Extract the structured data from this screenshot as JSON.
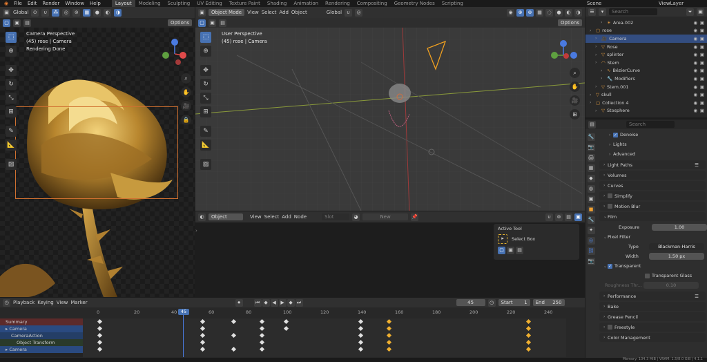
{
  "topbar": {
    "menus": [
      "File",
      "Edit",
      "Render",
      "Window",
      "Help"
    ],
    "workspaces": [
      "Layout",
      "Modeling",
      "Sculpting",
      "UV Editing",
      "Texture Paint",
      "Shading",
      "Animation",
      "Rendering",
      "Compositing",
      "Geometry Nodes",
      "Scripting"
    ],
    "active_workspace": "Layout",
    "scene": "Scene",
    "view_layer": "ViewLayer"
  },
  "left_viewport": {
    "orientation": "Global",
    "options": "Options",
    "title": "Camera Perspective",
    "subtitle": "(45) rose | Camera",
    "status": "Rendering Done"
  },
  "main_viewport": {
    "mode": "Object Mode",
    "menus": [
      "View",
      "Select",
      "Add",
      "Object"
    ],
    "orientation": "Global",
    "options": "Options",
    "title": "User Perspective",
    "subtitle": "(45) rose | Camera"
  },
  "node_editor": {
    "mode": "Object",
    "menus": [
      "View",
      "Select",
      "Add",
      "Node"
    ],
    "slot": "Slot",
    "new": "New",
    "active_tool_title": "Active Tool",
    "active_tool": "Select Box"
  },
  "outliner": {
    "search_placeholder": "Search",
    "items": [
      {
        "label": "Area.002",
        "indent": 2,
        "sel": false
      },
      {
        "label": "rose",
        "indent": 0,
        "sel": false
      },
      {
        "label": "Camera",
        "indent": 1,
        "sel": true
      },
      {
        "label": "Rose",
        "indent": 1,
        "sel": false
      },
      {
        "label": "splinter",
        "indent": 1,
        "sel": false
      },
      {
        "label": "Stem",
        "indent": 1,
        "sel": false
      },
      {
        "label": "BézierCurve",
        "indent": 2,
        "sel": false
      },
      {
        "label": "Modifiers",
        "indent": 2,
        "sel": false
      },
      {
        "label": "Stem.001",
        "indent": 1,
        "sel": false
      },
      {
        "label": "skull",
        "indent": 0,
        "sel": false
      },
      {
        "label": "Collection 4",
        "indent": 0,
        "sel": false
      },
      {
        "label": "Stosphere",
        "indent": 1,
        "sel": false
      }
    ]
  },
  "properties": {
    "search_placeholder": "Search",
    "denoise": "Denoise",
    "lights": "Lights",
    "advanced": "Advanced",
    "light_paths": "Light Paths",
    "volumes": "Volumes",
    "curves": "Curves",
    "simplify": "Simplify",
    "motion_blur": "Motion Blur",
    "film": "Film",
    "exposure_label": "Exposure",
    "exposure_value": "1.00",
    "pixel_filter": "Pixel Filter",
    "type_label": "Type",
    "type_value": "Blackman-Harris",
    "width_label": "Width",
    "width_value": "1.50 px",
    "transparent": "Transparent",
    "transparent_glass": "Transparent Glass",
    "roughness_label": "Roughness Thr...",
    "roughness_value": "0.10",
    "performance": "Performance",
    "bake": "Bake",
    "grease_pencil": "Grease Pencil",
    "freestyle": "Freestyle",
    "color_management": "Color Management"
  },
  "timeline": {
    "menus": [
      "Playback",
      "Keying",
      "View",
      "Marker"
    ],
    "current_frame": "45",
    "start_label": "Start",
    "start_value": "1",
    "end_label": "End",
    "end_value": "250",
    "ticks": [
      "0",
      "20",
      "40",
      "45",
      "60",
      "80",
      "100",
      "120",
      "140",
      "160",
      "180",
      "200",
      "220",
      "240"
    ],
    "channels": [
      "Summary",
      "Camera",
      "CameraAction",
      "Object Transform",
      "Camera"
    ]
  },
  "statusbar": {
    "memory": "Memory: 104.3 MiB | VRAM: 1.5/8.0 GiB | 4.1.1"
  }
}
